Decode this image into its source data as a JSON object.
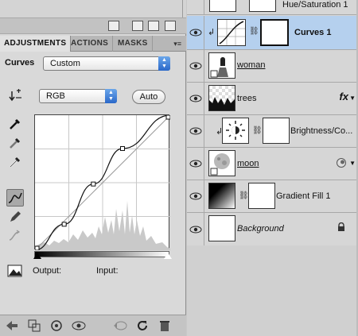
{
  "colors": {
    "selected_row": "#b5d0ee",
    "select_arrow": "#2a68c9"
  },
  "adjustments_panel": {
    "tabs": [
      {
        "label": "ADJUSTMENTS",
        "active": true
      },
      {
        "label": "ACTIONS",
        "active": false
      },
      {
        "label": "MASKS",
        "active": false
      }
    ],
    "tab_menu_icon": "panel-menu-icon",
    "preset_label": "Curves",
    "preset_value": "Custom",
    "channel_value": "RGB",
    "auto_label": "Auto",
    "output_label": "Output:",
    "input_label": "Input:",
    "curve_points": [
      {
        "input": 0,
        "output": 0
      },
      {
        "input": 55,
        "output": 55
      },
      {
        "input": 110,
        "output": 110
      },
      {
        "input": 165,
        "output": 165
      },
      {
        "input": 255,
        "output": 255
      }
    ]
  },
  "layers_panel": {
    "layers": [
      {
        "name": "Hue/Saturation 1",
        "type": "adjustment",
        "selected": false,
        "clipped": false
      },
      {
        "name": "Curves 1",
        "type": "adjustment",
        "selected": true,
        "clipped": true
      },
      {
        "name": "woman",
        "type": "smart",
        "selected": false,
        "clipped": false
      },
      {
        "name": "trees",
        "type": "pixel",
        "selected": false,
        "clipped": false,
        "fx": "fx"
      },
      {
        "name": "Brightness/Co...",
        "type": "adjustment",
        "selected": false,
        "clipped": true
      },
      {
        "name": "moon",
        "type": "smart",
        "selected": false,
        "clipped": false
      },
      {
        "name": "Gradient Fill 1",
        "type": "fill",
        "selected": false,
        "clipped": false
      },
      {
        "name": "Background",
        "type": "background",
        "selected": false,
        "clipped": false,
        "locked": true
      }
    ]
  }
}
